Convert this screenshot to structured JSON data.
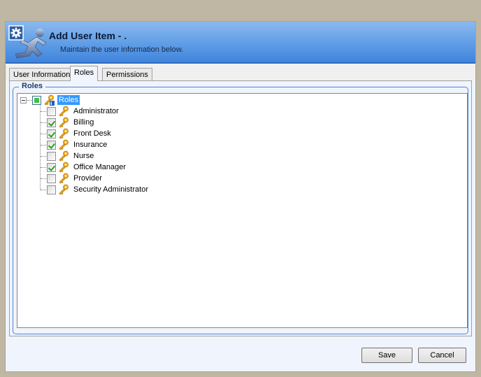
{
  "header": {
    "title": "Add User Item - .",
    "subtitle": "Maintain the user information below.",
    "icon": "running-person-gear-icon"
  },
  "tabs": [
    {
      "label": "User Information",
      "active": false
    },
    {
      "label": "Roles",
      "active": true
    },
    {
      "label": "Permissions",
      "active": false
    }
  ],
  "group": {
    "legend": "Roles"
  },
  "tree": {
    "root": {
      "label": "Roles",
      "state": "indeterminate",
      "expanded": true,
      "selected": true,
      "icon": "key-group-icon"
    },
    "items": [
      {
        "label": "Administrator",
        "checked": false,
        "icon": "key-icon"
      },
      {
        "label": "Billing",
        "checked": true,
        "icon": "key-icon"
      },
      {
        "label": "Front Desk",
        "checked": true,
        "icon": "key-icon"
      },
      {
        "label": "Insurance",
        "checked": true,
        "icon": "key-icon"
      },
      {
        "label": "Nurse",
        "checked": false,
        "icon": "key-icon"
      },
      {
        "label": "Office Manager",
        "checked": true,
        "icon": "key-icon"
      },
      {
        "label": "Provider",
        "checked": false,
        "icon": "key-icon"
      },
      {
        "label": "Security Administrator",
        "checked": false,
        "icon": "key-icon"
      }
    ]
  },
  "buttons": {
    "save": "Save",
    "cancel": "Cancel"
  },
  "colors": {
    "header_top": "#8db9ee",
    "header_bottom": "#3f84dc",
    "selection": "#3399ff",
    "check": "#21a121",
    "group_border": "#4a86d4"
  }
}
